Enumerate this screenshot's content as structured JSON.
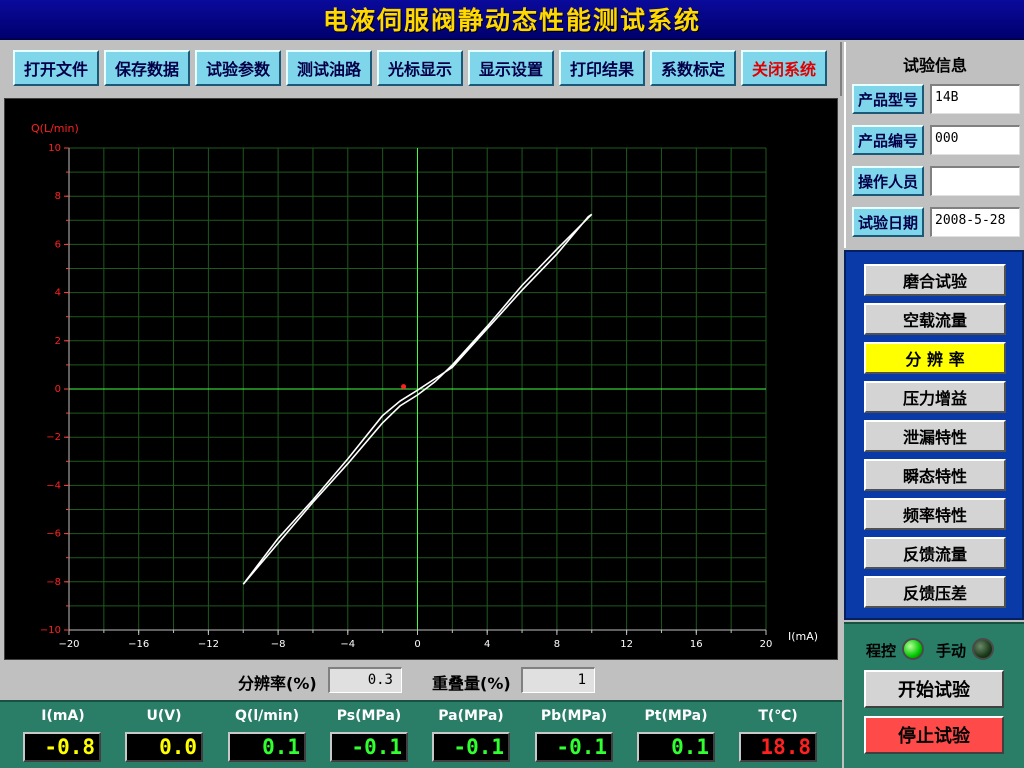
{
  "title": "电液伺服阀静动态性能测试系统",
  "toolbar": {
    "buttons": [
      {
        "label": "打开文件"
      },
      {
        "label": "保存数据"
      },
      {
        "label": "试验参数"
      },
      {
        "label": "测试油路"
      },
      {
        "label": "光标显示"
      },
      {
        "label": "显示设置"
      },
      {
        "label": "打印结果"
      },
      {
        "label": "系数标定"
      },
      {
        "label": "关闭系统"
      }
    ]
  },
  "chart_data": {
    "type": "line",
    "title": "",
    "xlabel": "I(mA)",
    "ylabel": "Q(L/min)",
    "xlim": [
      -20,
      20
    ],
    "ylim": [
      -10,
      10
    ],
    "xticks": [
      -20,
      -16,
      -12,
      -8,
      -4,
      0,
      4,
      8,
      12,
      16,
      20
    ],
    "yticks": [
      -10,
      -8,
      -6,
      -4,
      -2,
      0,
      2,
      4,
      6,
      8,
      10
    ],
    "grid": true,
    "series": [
      {
        "color": "#ffffff",
        "x": [
          -10,
          -8,
          -6,
          -4,
          -2,
          -1,
          0,
          1,
          2,
          4,
          6,
          8,
          10,
          9.8,
          8,
          6,
          4,
          2,
          0,
          -1,
          -2,
          -4,
          -6,
          -8,
          -10
        ],
        "y": [
          -8.1,
          -6.4,
          -4.7,
          -3.1,
          -1.4,
          -0.7,
          -0.25,
          0.3,
          1.0,
          2.6,
          4.3,
          5.8,
          7.25,
          7.15,
          5.6,
          4.1,
          2.5,
          0.9,
          -0.05,
          -0.5,
          -1.1,
          -2.9,
          -4.6,
          -6.2,
          -8.1
        ]
      }
    ],
    "marker": {
      "color": "#ff2020",
      "x": -0.8,
      "y": 0.1
    }
  },
  "stats": {
    "resolution_label": "分辨率(%)",
    "resolution_value": "0.3",
    "overlap_label": "重叠量(%)",
    "overlap_value": "1"
  },
  "readouts": [
    {
      "label": "I(mA)",
      "value": "-0.8",
      "color": "#ffff00"
    },
    {
      "label": "U(V)",
      "value": "0.0",
      "color": "#ffff00"
    },
    {
      "label": "Q(l/min)",
      "value": "0.1",
      "color": "#30ff30"
    },
    {
      "label": "Ps(MPa)",
      "value": "-0.1",
      "color": "#30ff30"
    },
    {
      "label": "Pa(MPa)",
      "value": "-0.1",
      "color": "#30ff30"
    },
    {
      "label": "Pb(MPa)",
      "value": "-0.1",
      "color": "#30ff30"
    },
    {
      "label": "Pt(MPa)",
      "value": "0.1",
      "color": "#30ff30"
    },
    {
      "label": "T(℃)",
      "value": "18.8",
      "color": "#ff2020"
    }
  ],
  "info": {
    "title": "试验信息",
    "fields": [
      {
        "label": "产品型号",
        "value": "14B"
      },
      {
        "label": "产品编号",
        "value": "000"
      },
      {
        "label": "操作人员",
        "value": ""
      },
      {
        "label": "试验日期",
        "value": "2008-5-28"
      }
    ]
  },
  "tests": [
    {
      "label": "磨合试验",
      "active": false
    },
    {
      "label": "空载流量",
      "active": false
    },
    {
      "label": "分 辨 率",
      "active": true
    },
    {
      "label": "压力增益",
      "active": false
    },
    {
      "label": "泄漏特性",
      "active": false
    },
    {
      "label": "瞬态特性",
      "active": false
    },
    {
      "label": "频率特性",
      "active": false
    },
    {
      "label": "反馈流量",
      "active": false
    },
    {
      "label": "反馈压差",
      "active": false
    }
  ],
  "control": {
    "program_label": "程控",
    "manual_label": "手动",
    "program_on": true,
    "manual_on": false,
    "start_label": "开始试验",
    "stop_label": "停止试验"
  }
}
